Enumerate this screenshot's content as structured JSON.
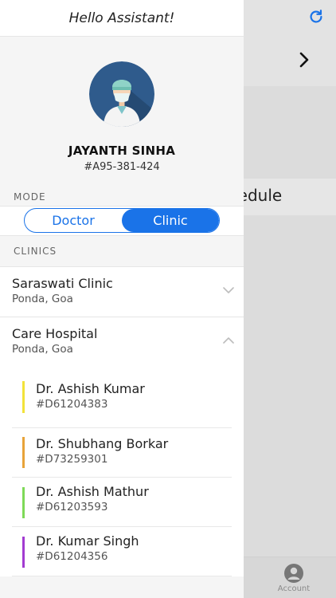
{
  "background": {
    "schedule_text": "hedule",
    "account_label": "Account"
  },
  "drawer": {
    "title": "Hello Assistant!",
    "profile": {
      "name": "JAYANTH SINHA",
      "id": "#A95-381-424"
    },
    "mode": {
      "label": "MODE",
      "options": [
        "Doctor",
        "Clinic"
      ],
      "selected": "Clinic"
    },
    "clinics_label": "CLINICS",
    "clinics": [
      {
        "name": "Saraswati Clinic",
        "location": "Ponda, Goa",
        "expanded": false
      },
      {
        "name": "Care Hospital",
        "location": "Ponda, Goa",
        "expanded": true,
        "doctors": [
          {
            "name": "Dr. Ashish Kumar",
            "id": "#D61204383",
            "color": "#f2e23a"
          },
          {
            "name": "Dr. Shubhang Borkar",
            "id": "#D73259301",
            "color": "#e8a33a"
          },
          {
            "name": "Dr. Ashish Mathur",
            "id": "#D61203593",
            "color": "#7ed957"
          },
          {
            "name": "Dr. Kumar Singh",
            "id": "#D61204356",
            "color": "#a23bd1"
          }
        ]
      }
    ]
  },
  "colors": {
    "accent": "#1a73e8"
  }
}
